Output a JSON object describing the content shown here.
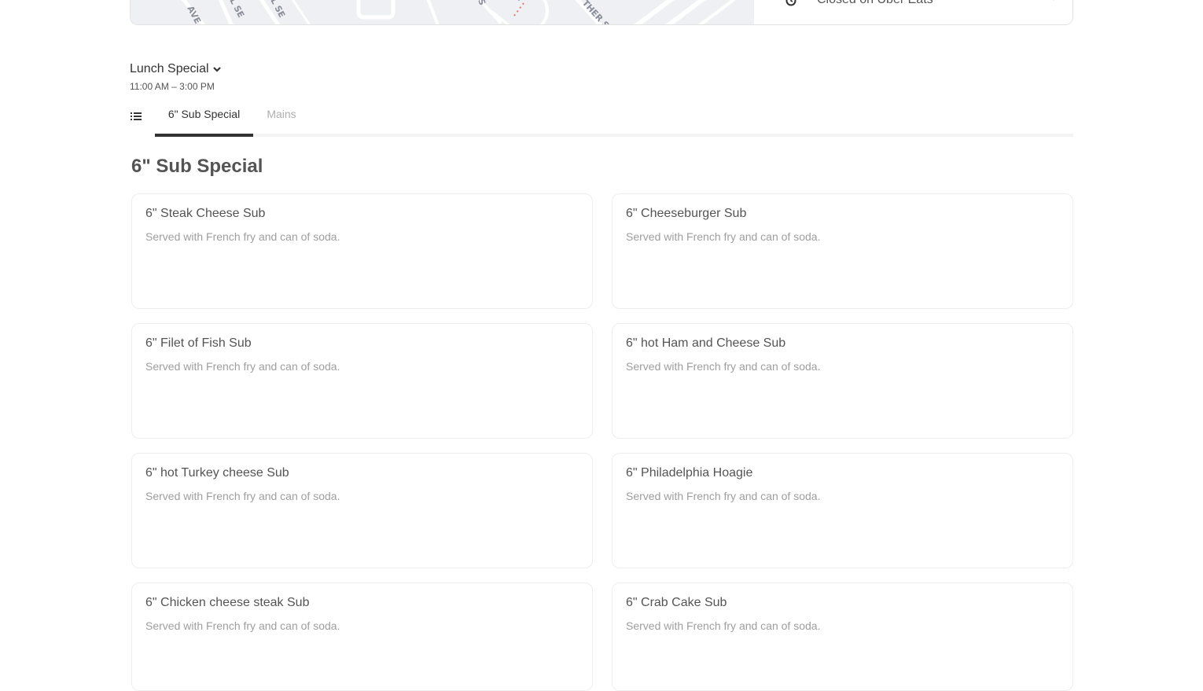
{
  "map": {
    "street_labels": [
      "AVE S",
      "L SE",
      "L SE",
      "S",
      "S",
      "THER ST"
    ]
  },
  "store_status": {
    "text": "Closed on Uber Eats"
  },
  "menu": {
    "title": "Lunch Special",
    "hours": "11:00 AM – 3:00 PM"
  },
  "tabs": [
    {
      "label": "6\" Sub Special",
      "active": true
    },
    {
      "label": "Mains",
      "active": false
    }
  ],
  "section": {
    "title": "6\" Sub Special",
    "items": [
      {
        "name": "6\" Steak Cheese Sub",
        "description": "Served with French fry and can of soda."
      },
      {
        "name": "6\" Cheeseburger Sub",
        "description": "Served with French fry and can of soda."
      },
      {
        "name": "6\" Filet of Fish Sub",
        "description": "Served with French fry and can of soda."
      },
      {
        "name": "6\" hot Ham and Cheese Sub",
        "description": "Served with French fry and can of soda."
      },
      {
        "name": "6\" hot Turkey cheese Sub",
        "description": "Served with French fry and can of soda."
      },
      {
        "name": "6\" Philadelphia Hoagie",
        "description": "Served with French fry and can of soda."
      },
      {
        "name": "6\" Chicken cheese steak Sub",
        "description": "Served with French fry and can of soda."
      },
      {
        "name": "6\" Crab Cake Sub",
        "description": "Served with French fry and can of soda."
      }
    ]
  },
  "colors": {
    "text_primary": "#333333",
    "text_secondary": "#545454",
    "text_muted": "#9e9e9e",
    "tab_inactive": "#afafaf",
    "border": "#eeeeee"
  },
  "icons": [
    "clock-icon",
    "chevron-down-icon",
    "list-icon"
  ]
}
